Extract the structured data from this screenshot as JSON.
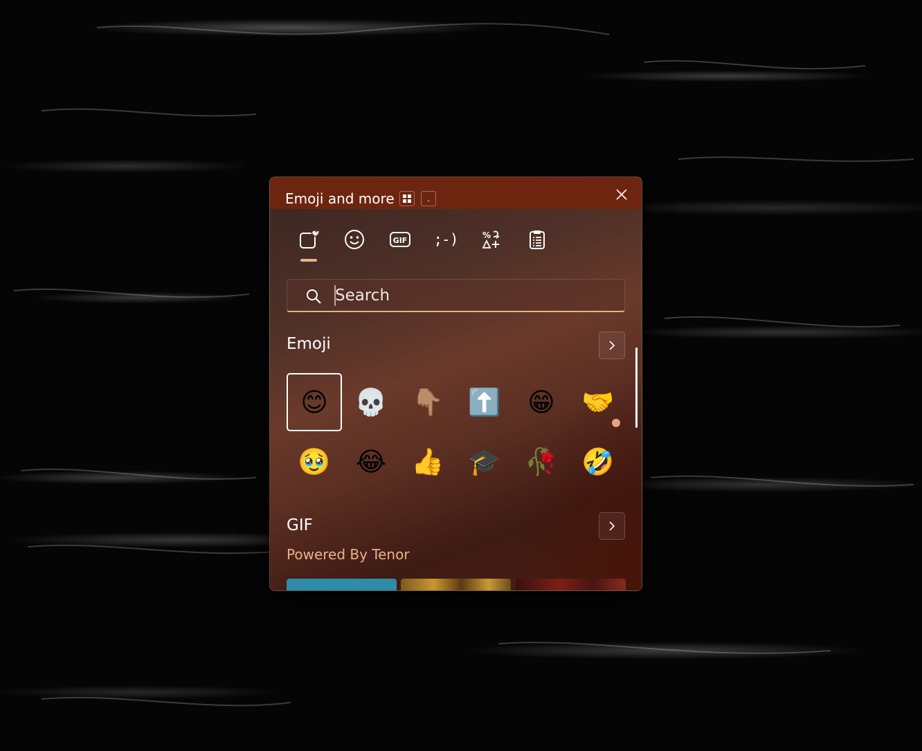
{
  "window": {
    "title": "Emoji and more",
    "hint_keys": [
      "⊞",
      "."
    ],
    "close_label": "Close"
  },
  "tabs": [
    {
      "name": "favorites",
      "icon": "heart-note-icon",
      "label": "Most recently used",
      "selected": true
    },
    {
      "name": "emoji",
      "icon": "smiley-icon",
      "label": "Emoji"
    },
    {
      "name": "gif",
      "icon": "gif-icon",
      "label": "GIF"
    },
    {
      "name": "kaomoji",
      "icon": "kaomoji-icon",
      "label": ";-)"
    },
    {
      "name": "symbols",
      "icon": "symbols-icon",
      "label": "Symbols"
    },
    {
      "name": "clipboard",
      "icon": "clipboard-icon",
      "label": "Clipboard history"
    }
  ],
  "search": {
    "placeholder": "Search",
    "value": ""
  },
  "emoji_section": {
    "title": "Emoji",
    "items": [
      {
        "char": "😊",
        "name": "smiling-face-with-smiling-eyes"
      },
      {
        "char": "💀",
        "name": "skull"
      },
      {
        "char": "👇🏽",
        "name": "backhand-index-pointing-down"
      },
      {
        "char": "⬆️",
        "name": "up-arrow"
      },
      {
        "char": "😁",
        "name": "beaming-face"
      },
      {
        "char": "🤝",
        "name": "handshake"
      },
      {
        "char": "🥹",
        "name": "face-holding-back-tears"
      },
      {
        "char": "😂",
        "name": "face-with-tears-of-joy"
      },
      {
        "char": "👍",
        "name": "thumbs-up"
      },
      {
        "char": "🎓",
        "name": "graduation-cap"
      },
      {
        "char": "🥀",
        "name": "wilted-flower"
      },
      {
        "char": "🤣",
        "name": "rolling-on-the-floor-laughing"
      }
    ]
  },
  "gif_section": {
    "title": "GIF",
    "subtitle": "Powered By Tenor",
    "thumb_colors": [
      "#2f8ca8",
      "#b9892e",
      "#6a1c18"
    ]
  },
  "colors": {
    "accent": "#e8b389",
    "title_bar": "#6d2510"
  }
}
